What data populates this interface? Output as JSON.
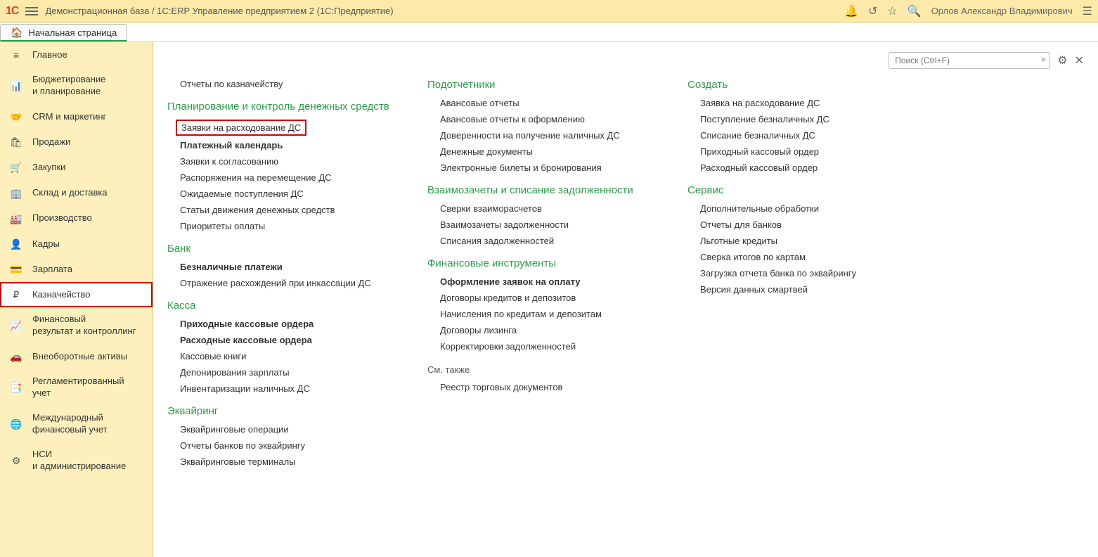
{
  "topbar": {
    "logo": "1C",
    "title": "Демонстрационная база / 1C:ERP Управление предприятием 2  (1C:Предприятие)",
    "username": "Орлов Александр Владимирович"
  },
  "tab": {
    "label": "Начальная страница"
  },
  "sidebar": {
    "items": [
      {
        "icon": "≡",
        "label": "Главное"
      },
      {
        "icon": "📊",
        "label": "Бюджетирование\nи планирование"
      },
      {
        "icon": "🤝",
        "label": "CRM и маркетинг"
      },
      {
        "icon": "🛍",
        "label": "Продажи"
      },
      {
        "icon": "🛒",
        "label": "Закупки"
      },
      {
        "icon": "🏢",
        "label": "Склад и доставка"
      },
      {
        "icon": "🏭",
        "label": "Производство"
      },
      {
        "icon": "👤",
        "label": "Кадры"
      },
      {
        "icon": "💳",
        "label": "Зарплата"
      },
      {
        "icon": "₽",
        "label": "Казначейство",
        "active": true
      },
      {
        "icon": "📈",
        "label": "Финансовый\nрезультат и контроллинг"
      },
      {
        "icon": "🚗",
        "label": "Внеоборотные активы"
      },
      {
        "icon": "📑",
        "label": "Регламентированный\nучет"
      },
      {
        "icon": "🌐",
        "label": "Международный\nфинансовый учет"
      },
      {
        "icon": "⚙",
        "label": "НСИ\nи администрирование"
      }
    ]
  },
  "search": {
    "placeholder": "Поиск (Ctrl+F)"
  },
  "col1": {
    "reports": "Отчеты по казначейству",
    "g1": {
      "header": "Планирование и контроль денежных средств",
      "items": [
        {
          "t": "Заявки на расходование ДС",
          "hl": true
        },
        {
          "t": "Платежный календарь",
          "b": true
        },
        {
          "t": "Заявки к согласованию"
        },
        {
          "t": "Распоряжения на перемещение ДС"
        },
        {
          "t": "Ожидаемые поступления ДС"
        },
        {
          "t": "Статьи движения денежных средств"
        },
        {
          "t": "Приоритеты оплаты"
        }
      ]
    },
    "g2": {
      "header": "Банк",
      "items": [
        {
          "t": "Безналичные платежи",
          "b": true
        },
        {
          "t": "Отражение расхождений при инкассации ДС"
        }
      ]
    },
    "g3": {
      "header": "Касса",
      "items": [
        {
          "t": "Приходные кассовые ордера",
          "b": true
        },
        {
          "t": "Расходные кассовые ордера",
          "b": true
        },
        {
          "t": "Кассовые книги"
        },
        {
          "t": "Депонирования зарплаты"
        },
        {
          "t": "Инвентаризации наличных ДС"
        }
      ]
    },
    "g4": {
      "header": "Эквайринг",
      "items": [
        {
          "t": "Эквайринговые операции"
        },
        {
          "t": "Отчеты банков по эквайрингу"
        },
        {
          "t": "Эквайринговые терминалы"
        }
      ]
    }
  },
  "col2": {
    "g1": {
      "header": "Подотчетники",
      "items": [
        {
          "t": "Авансовые отчеты"
        },
        {
          "t": "Авансовые отчеты к оформлению"
        },
        {
          "t": "Доверенности на получение наличных ДС"
        },
        {
          "t": "Денежные документы"
        },
        {
          "t": "Электронные билеты и бронирования"
        }
      ]
    },
    "g2": {
      "header": "Взаимозачеты и списание задолженности",
      "items": [
        {
          "t": "Сверки взаиморасчетов"
        },
        {
          "t": "Взаимозачеты задолженности"
        },
        {
          "t": "Списания задолженностей"
        }
      ]
    },
    "g3": {
      "header": "Финансовые инструменты",
      "items": [
        {
          "t": "Оформление заявок на оплату",
          "b": true
        },
        {
          "t": "Договоры кредитов и депозитов"
        },
        {
          "t": "Начисления по кредитам и депозитам"
        },
        {
          "t": "Договоры лизинга"
        },
        {
          "t": "Корректировки задолженностей"
        }
      ]
    },
    "also": {
      "header": "См. также",
      "items": [
        {
          "t": "Реестр торговых документов"
        }
      ]
    }
  },
  "col3": {
    "g1": {
      "header": "Создать",
      "items": [
        {
          "t": "Заявка на расходование ДС"
        },
        {
          "t": "Поступление безналичных ДС"
        },
        {
          "t": "Списание безналичных ДС"
        },
        {
          "t": "Приходный кассовый ордер"
        },
        {
          "t": "Расходный кассовый ордер"
        }
      ]
    },
    "g2": {
      "header": "Сервис",
      "items": [
        {
          "t": "Дополнительные обработки"
        },
        {
          "t": "Отчеты для банков"
        },
        {
          "t": "Льготные кредиты"
        },
        {
          "t": "Сверка итогов по картам"
        },
        {
          "t": "Загрузка отчета банка по эквайрингу"
        },
        {
          "t": "Версия данных смартвей"
        }
      ]
    }
  }
}
